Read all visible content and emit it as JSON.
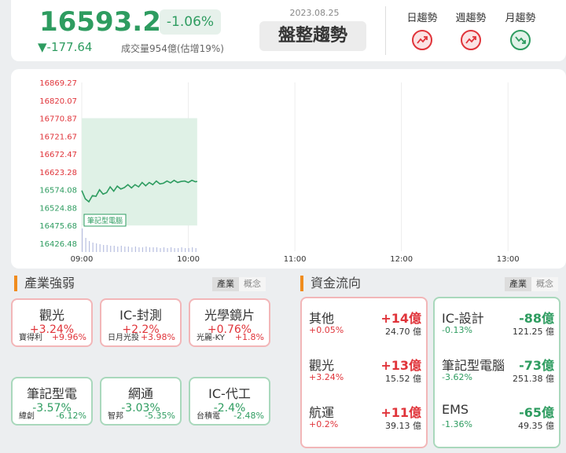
{
  "header": {
    "price": "16593.23",
    "change_pct": "-1.06%",
    "change_points": "▼-177.64",
    "volume": "成交量954億(估增19%)",
    "date": "2023.08.25",
    "trend_status": "盤整趨勢",
    "trends": [
      {
        "label": "日趨勢",
        "icon": "trend-up-icon",
        "direction": "up"
      },
      {
        "label": "週趨勢",
        "icon": "trend-up-icon",
        "direction": "up"
      },
      {
        "label": "月趨勢",
        "icon": "trend-down-icon",
        "direction": "down"
      }
    ]
  },
  "chart_data": {
    "type": "line",
    "y_ticks": [
      "16869.27",
      "16820.07",
      "16770.87",
      "16721.67",
      "16672.47",
      "16623.28",
      "16574.08",
      "16524.88",
      "16475.68",
      "16426.48"
    ],
    "x_ticks": [
      "09:00",
      "10:00",
      "11:00",
      "12:00",
      "13:00"
    ],
    "ylim": [
      16426.48,
      16869.27
    ],
    "x_range_minutes": [
      0,
      270
    ],
    "series": [
      {
        "x": [
          0,
          2,
          4,
          6,
          8,
          10,
          12,
          14,
          16,
          18,
          20,
          22,
          24,
          26,
          28,
          30,
          32,
          34,
          36,
          38,
          40,
          42,
          44,
          46,
          48,
          50,
          52,
          54,
          56,
          58,
          60,
          62,
          64,
          65
        ],
        "y": [
          16572,
          16549,
          16541,
          16558,
          16556,
          16574,
          16562,
          16566,
          16582,
          16570,
          16584,
          16576,
          16580,
          16588,
          16579,
          16588,
          16582,
          16594,
          16585,
          16594,
          16588,
          16598,
          16590,
          16592,
          16598,
          16593,
          16600,
          16594,
          16597,
          16598,
          16594,
          16600,
          16596,
          16597
        ]
      }
    ],
    "range_box": {
      "x_start": 0,
      "x_end": 65,
      "y_high": 16770.87,
      "y_low": 16475.68
    },
    "volume": [
      30,
      18,
      14,
      12,
      11,
      10,
      9,
      9,
      8,
      8,
      7,
      8,
      7,
      7,
      6,
      7,
      6,
      6,
      7,
      6,
      6,
      6,
      5,
      6,
      5,
      6,
      5,
      5,
      6,
      5,
      5,
      6,
      5
    ],
    "annotation": "筆記型電腦"
  },
  "sectors": {
    "title": "產業強弱",
    "tabs": [
      "產業",
      "概念"
    ],
    "items": [
      {
        "name": "觀光",
        "pct": "+3.24%",
        "stock": "寶得利",
        "stock_pct": "+9.96%",
        "dir": "up"
      },
      {
        "name": "IC-封測",
        "pct": "+2.2%",
        "stock": "日月光投",
        "stock_pct": "+3.98%",
        "dir": "up"
      },
      {
        "name": "光學鏡片",
        "pct": "+0.76%",
        "stock": "光麗-KY",
        "stock_pct": "+1.8%",
        "dir": "up"
      },
      {
        "name": "筆記型電",
        "pct": "-3.57%",
        "stock": "緯創",
        "stock_pct": "-6.12%",
        "dir": "down"
      },
      {
        "name": "網通",
        "pct": "-3.03%",
        "stock": "智邦",
        "stock_pct": "-5.35%",
        "dir": "down"
      },
      {
        "name": "IC-代工",
        "pct": "-2.4%",
        "stock": "台積電",
        "stock_pct": "-2.48%",
        "dir": "down"
      }
    ]
  },
  "fund_flow": {
    "title": "資金流向",
    "tabs": [
      "產業",
      "概念"
    ],
    "inflow": [
      {
        "name": "其他",
        "amount": "+14億",
        "pct": "+0.05%",
        "value": "24.70 億"
      },
      {
        "name": "觀光",
        "amount": "+13億",
        "pct": "+3.24%",
        "value": "15.52 億"
      },
      {
        "name": "航運",
        "amount": "+11億",
        "pct": "+0.2%",
        "value": "39.13 億"
      }
    ],
    "outflow": [
      {
        "name": "IC-設計",
        "amount": "-88億",
        "pct": "-0.13%",
        "value": "121.25 億"
      },
      {
        "name": "筆記型電腦",
        "amount": "-73億",
        "pct": "-3.62%",
        "value": "251.38 億"
      },
      {
        "name": "EMS",
        "amount": "-65億",
        "pct": "-1.36%",
        "value": "49.35 億"
      }
    ]
  },
  "colors": {
    "up": "#e0343a",
    "down": "#2e9c60",
    "accent": "#f08c1e"
  }
}
